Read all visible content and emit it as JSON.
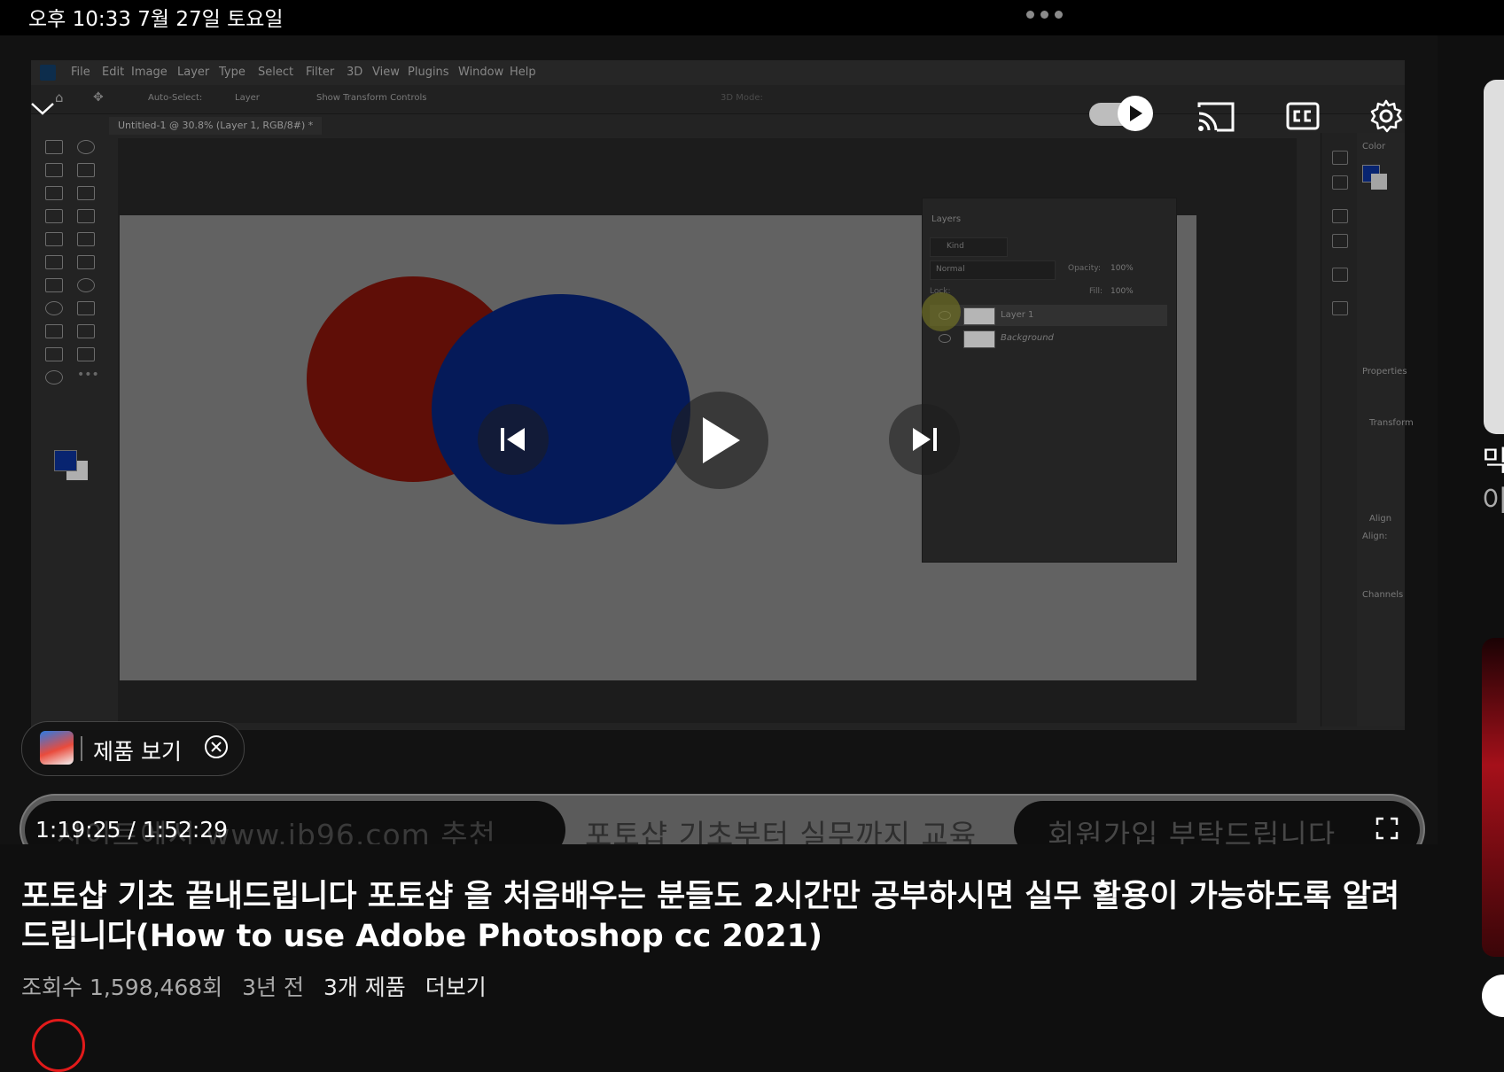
{
  "status_bar": {
    "time_date": "오후 10:33   7월 27일 토요일"
  },
  "video": {
    "time_current_total": "1:19:25 / 1:52:29",
    "progress_fraction": 0.705,
    "banner": {
      "segments": [
        "사이트에서 www.ib96.com 추천",
        "포토샵 기초부터 실무까지 교육",
        "회원가입 부탁드립니다"
      ]
    },
    "product_pill_label": "제품 보기",
    "accent_color": "#e21a1a"
  },
  "photoshop": {
    "menu": [
      "File",
      "Edit",
      "Image",
      "Layer",
      "Type",
      "Select",
      "Filter",
      "3D",
      "View",
      "Plugins",
      "Window",
      "Help"
    ],
    "options": {
      "auto_select": "Auto-Select:",
      "layer_dropdown": "Layer",
      "show_transform": "Show Transform Controls",
      "mode": "3D Mode:"
    },
    "doc_tab": "Untitled-1 @ 30.8% (Layer 1, RGB/8#) *",
    "layers_panel": {
      "title": "Layers",
      "kind": "Kind",
      "blend": "Normal",
      "opacity_label": "Opacity:",
      "opacity_value": "100%",
      "lock_label": "Lock:",
      "fill_label": "Fill:",
      "fill_value": "100%",
      "layers": [
        "Layer 1",
        "Background"
      ]
    },
    "right_panels": {
      "color": "Color",
      "properties": "Properties",
      "transform": "Transform",
      "align": "Align",
      "align_sub": "Align:",
      "channels": "Channels"
    }
  },
  "video_title": "포토샵 기초 끝내드립니다 포토샵 을 처음배우는 분들도 2시간만 공부하시면 실무 활용이 가능하도록 알려드립니다(How to use Adobe Photoshop cc 2021)",
  "meta": {
    "views": "조회수 1,598,468회",
    "age": "3년 전",
    "products": "3개 제품",
    "more": "더보기"
  },
  "side": {
    "char1": "믹",
    "char2": "이"
  }
}
